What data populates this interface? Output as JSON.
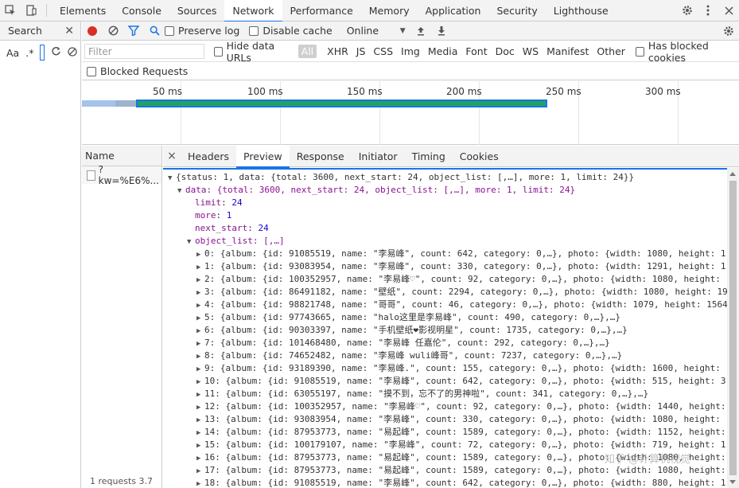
{
  "topbar": {
    "tabs": [
      "Elements",
      "Console",
      "Sources",
      "Network",
      "Performance",
      "Memory",
      "Application",
      "Security",
      "Lighthouse"
    ],
    "active_tab": "Network"
  },
  "search_panel": {
    "title": "Search",
    "match_case": "Aa",
    "regex": ".*"
  },
  "toolbar": {
    "preserve_log": "Preserve log",
    "disable_cache": "Disable cache",
    "throttling": "Online"
  },
  "filter": {
    "placeholder": "Filter",
    "hide_data_urls": "Hide data URLs",
    "types": [
      "All",
      "XHR",
      "JS",
      "CSS",
      "Img",
      "Media",
      "Font",
      "Doc",
      "WS",
      "Manifest",
      "Other"
    ],
    "has_blocked_cookies": "Has blocked cookies",
    "blocked_requests": "Blocked Requests"
  },
  "timeline": {
    "labels": [
      "50 ms",
      "100 ms",
      "150 ms",
      "200 ms",
      "250 ms",
      "300 ms"
    ]
  },
  "requests": {
    "column_name": "Name",
    "rows": [
      {
        "name": "?kw=%E6%..."
      }
    ],
    "summary": "1 requests  3.7"
  },
  "detail_tabs": [
    "Headers",
    "Preview",
    "Response",
    "Initiator",
    "Timing",
    "Cookies"
  ],
  "preview": {
    "root": "{status: 1, data: {total: 3600, next_start: 24, object_list: [,…], more: 1, limit: 24}}",
    "data_line": "data: {total: 3600, next_start: 24, object_list: [,…], more: 1, limit: 24}",
    "limit_key": "limit",
    "limit_val": "24",
    "more_key": "more",
    "more_val": "1",
    "next_start_key": "next_start",
    "next_start_val": "24",
    "object_list_line": "object_list: [,…]",
    "items": [
      "0: {album: {id: 91085519, name: \"李易峰\", count: 642, category: 0,…}, photo: {width: 1080, height: 1",
      "1: {album: {id: 93083954, name: \"李易峰\", count: 330, category: 0,…}, photo: {width: 1291, height: 1",
      "2: {album: {id: 100352957, name: \"李易峰♡\", count: 92, category: 0,…}, photo: {width: 1080, height:",
      "3: {album: {id: 86491182, name: \"壁纸\", count: 2294, category: 0,…}, photo: {width: 1080, height: 19",
      "4: {album: {id: 98821748, name: \"哥哥\", count: 46, category: 0,…}, photo: {width: 1079, height: 1564",
      "5: {album: {id: 97743665, name: \"halo这里是李易峰\", count: 490, category: 0,…},…}",
      "6: {album: {id: 90303397, name: \"手机壁纸❤影视明星\", count: 1735, category: 0,…},…}",
      "7: {album: {id: 101468480, name: \"李易峰 任嘉伦\", count: 292, category: 0,…},…}",
      "8: {album: {id: 74652482, name: \"李易峰 wuli峰哥\", count: 7237, category: 0,…},…}",
      "9: {album: {id: 93189390, name: \"李易峰.\", count: 155, category: 0,…}, photo: {width: 1600, height:",
      "10: {album: {id: 91085519, name: \"李易峰\", count: 642, category: 0,…}, photo: {width: 515, height: 3",
      "11: {album: {id: 63055197, name: \"摸不到，忘不了的男神啦\", count: 341, category: 0,…},…}",
      "12: {album: {id: 100352957, name: \"李易峰♡\", count: 92, category: 0,…}, photo: {width: 1440, height:",
      "13: {album: {id: 93083954, name: \"李易峰\", count: 330, category: 0,…}, photo: {width: 1080, height:",
      "14: {album: {id: 87953773, name: \"易起峰\", count: 1589, category: 0,…}, photo: {width: 1152, height:",
      "15: {album: {id: 100179107, name: \"李易峰\", count: 72, category: 0,…}, photo: {width: 719, height: 1",
      "16: {album: {id: 87953773, name: \"易起峰\", count: 1589, category: 0,…}, photo: {width: 1080, height:",
      "17: {album: {id: 87953773, name: \"易起峰\", count: 1589, category: 0,…}, photo: {width: 1080, height:",
      "18: {album: {id: 91085519, name: \"李易峰\", count: 642, category: 0,…}, photo: {width: 880, height: 1"
    ]
  },
  "watermark": "知乎 @计算机视觉"
}
